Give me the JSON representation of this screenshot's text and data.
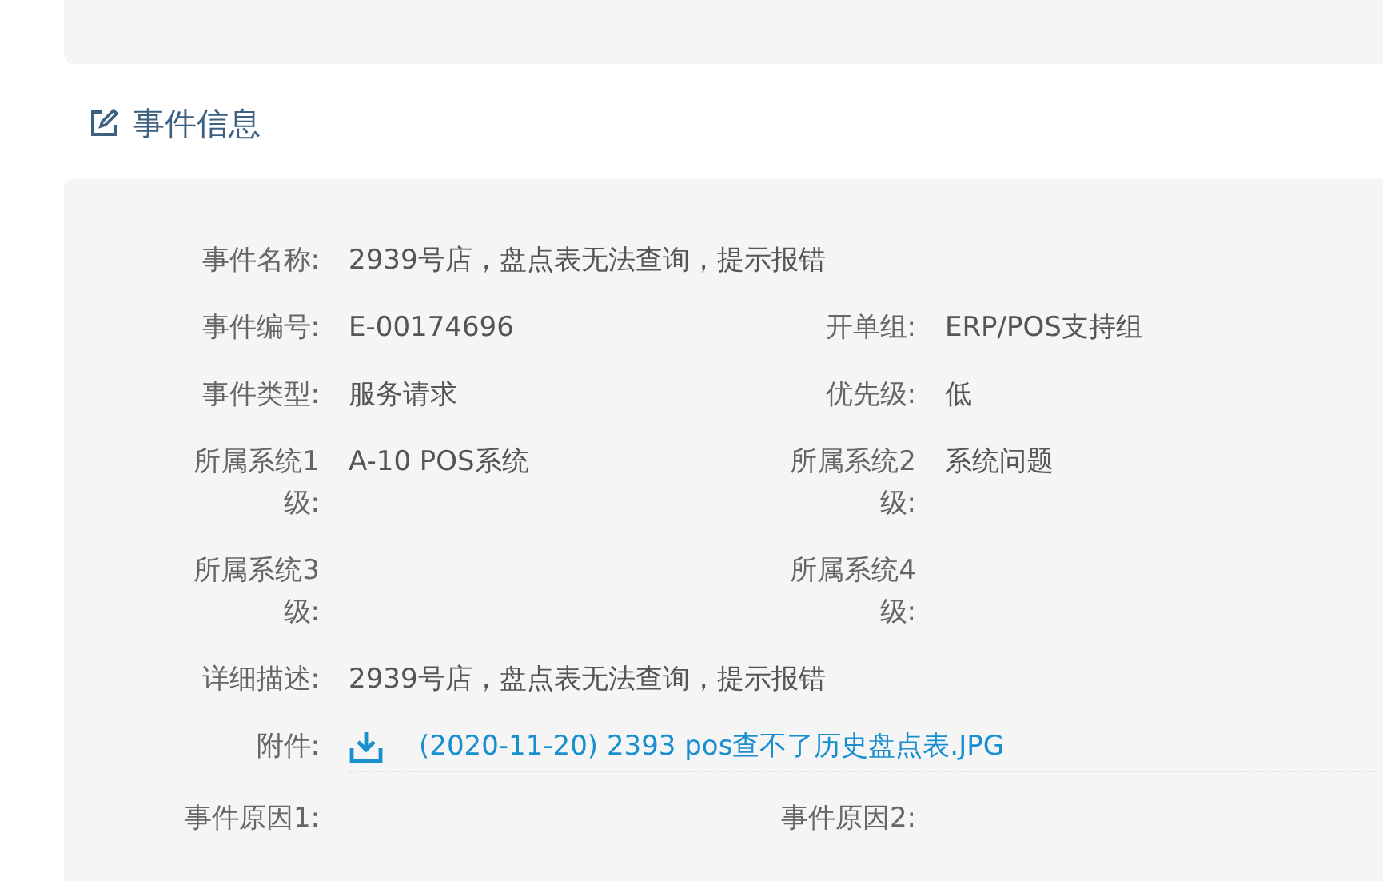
{
  "section": {
    "title": "事件信息"
  },
  "rows": [
    {
      "kind": "single",
      "fields": [
        {
          "label": "事件名称:",
          "value": "2939号店，盘点表无法查询，提示报错"
        }
      ]
    },
    {
      "kind": "pair",
      "fields": [
        {
          "label": "事件编号:",
          "value": "E-00174696"
        },
        {
          "label": "开单组:",
          "value": "ERP/POS支持组"
        }
      ]
    },
    {
      "kind": "pair",
      "fields": [
        {
          "label": "事件类型:",
          "value": "服务请求"
        },
        {
          "label": "优先级:",
          "value": "低"
        }
      ]
    },
    {
      "kind": "pair",
      "fields": [
        {
          "label": "所属系统1级:",
          "value": "A-10 POS系统"
        },
        {
          "label": "所属系统2级:",
          "value": "系统问题"
        }
      ]
    },
    {
      "kind": "pair",
      "fields": [
        {
          "label": "所属系统3级:"
        },
        {
          "label": "所属系统4级:"
        }
      ]
    },
    {
      "kind": "single",
      "fields": [
        {
          "label": "详细描述:",
          "value": "2939号店，盘点表无法查询，提示报错"
        }
      ]
    },
    {
      "kind": "attachment",
      "fields": [
        {
          "label": "附件:",
          "value": "(2020-11-20)  2393 pos查不了历史盘点表.JPG"
        }
      ]
    },
    {
      "kind": "pair",
      "fields": [
        {
          "label": "事件原因1:"
        },
        {
          "label": "事件原因2:"
        }
      ]
    }
  ]
}
